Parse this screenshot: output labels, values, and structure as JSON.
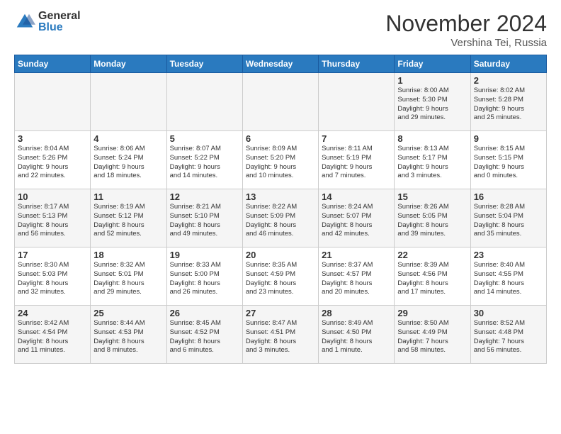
{
  "header": {
    "logo_general": "General",
    "logo_blue": "Blue",
    "month_title": "November 2024",
    "location": "Vershina Tei, Russia"
  },
  "days_of_week": [
    "Sunday",
    "Monday",
    "Tuesday",
    "Wednesday",
    "Thursday",
    "Friday",
    "Saturday"
  ],
  "weeks": [
    [
      {
        "day": "",
        "content": ""
      },
      {
        "day": "",
        "content": ""
      },
      {
        "day": "",
        "content": ""
      },
      {
        "day": "",
        "content": ""
      },
      {
        "day": "",
        "content": ""
      },
      {
        "day": "1",
        "content": "Sunrise: 8:00 AM\nSunset: 5:30 PM\nDaylight: 9 hours\nand 29 minutes."
      },
      {
        "day": "2",
        "content": "Sunrise: 8:02 AM\nSunset: 5:28 PM\nDaylight: 9 hours\nand 25 minutes."
      }
    ],
    [
      {
        "day": "3",
        "content": "Sunrise: 8:04 AM\nSunset: 5:26 PM\nDaylight: 9 hours\nand 22 minutes."
      },
      {
        "day": "4",
        "content": "Sunrise: 8:06 AM\nSunset: 5:24 PM\nDaylight: 9 hours\nand 18 minutes."
      },
      {
        "day": "5",
        "content": "Sunrise: 8:07 AM\nSunset: 5:22 PM\nDaylight: 9 hours\nand 14 minutes."
      },
      {
        "day": "6",
        "content": "Sunrise: 8:09 AM\nSunset: 5:20 PM\nDaylight: 9 hours\nand 10 minutes."
      },
      {
        "day": "7",
        "content": "Sunrise: 8:11 AM\nSunset: 5:19 PM\nDaylight: 9 hours\nand 7 minutes."
      },
      {
        "day": "8",
        "content": "Sunrise: 8:13 AM\nSunset: 5:17 PM\nDaylight: 9 hours\nand 3 minutes."
      },
      {
        "day": "9",
        "content": "Sunrise: 8:15 AM\nSunset: 5:15 PM\nDaylight: 9 hours\nand 0 minutes."
      }
    ],
    [
      {
        "day": "10",
        "content": "Sunrise: 8:17 AM\nSunset: 5:13 PM\nDaylight: 8 hours\nand 56 minutes."
      },
      {
        "day": "11",
        "content": "Sunrise: 8:19 AM\nSunset: 5:12 PM\nDaylight: 8 hours\nand 52 minutes."
      },
      {
        "day": "12",
        "content": "Sunrise: 8:21 AM\nSunset: 5:10 PM\nDaylight: 8 hours\nand 49 minutes."
      },
      {
        "day": "13",
        "content": "Sunrise: 8:22 AM\nSunset: 5:09 PM\nDaylight: 8 hours\nand 46 minutes."
      },
      {
        "day": "14",
        "content": "Sunrise: 8:24 AM\nSunset: 5:07 PM\nDaylight: 8 hours\nand 42 minutes."
      },
      {
        "day": "15",
        "content": "Sunrise: 8:26 AM\nSunset: 5:05 PM\nDaylight: 8 hours\nand 39 minutes."
      },
      {
        "day": "16",
        "content": "Sunrise: 8:28 AM\nSunset: 5:04 PM\nDaylight: 8 hours\nand 35 minutes."
      }
    ],
    [
      {
        "day": "17",
        "content": "Sunrise: 8:30 AM\nSunset: 5:03 PM\nDaylight: 8 hours\nand 32 minutes."
      },
      {
        "day": "18",
        "content": "Sunrise: 8:32 AM\nSunset: 5:01 PM\nDaylight: 8 hours\nand 29 minutes."
      },
      {
        "day": "19",
        "content": "Sunrise: 8:33 AM\nSunset: 5:00 PM\nDaylight: 8 hours\nand 26 minutes."
      },
      {
        "day": "20",
        "content": "Sunrise: 8:35 AM\nSunset: 4:59 PM\nDaylight: 8 hours\nand 23 minutes."
      },
      {
        "day": "21",
        "content": "Sunrise: 8:37 AM\nSunset: 4:57 PM\nDaylight: 8 hours\nand 20 minutes."
      },
      {
        "day": "22",
        "content": "Sunrise: 8:39 AM\nSunset: 4:56 PM\nDaylight: 8 hours\nand 17 minutes."
      },
      {
        "day": "23",
        "content": "Sunrise: 8:40 AM\nSunset: 4:55 PM\nDaylight: 8 hours\nand 14 minutes."
      }
    ],
    [
      {
        "day": "24",
        "content": "Sunrise: 8:42 AM\nSunset: 4:54 PM\nDaylight: 8 hours\nand 11 minutes."
      },
      {
        "day": "25",
        "content": "Sunrise: 8:44 AM\nSunset: 4:53 PM\nDaylight: 8 hours\nand 8 minutes."
      },
      {
        "day": "26",
        "content": "Sunrise: 8:45 AM\nSunset: 4:52 PM\nDaylight: 8 hours\nand 6 minutes."
      },
      {
        "day": "27",
        "content": "Sunrise: 8:47 AM\nSunset: 4:51 PM\nDaylight: 8 hours\nand 3 minutes."
      },
      {
        "day": "28",
        "content": "Sunrise: 8:49 AM\nSunset: 4:50 PM\nDaylight: 8 hours\nand 1 minute."
      },
      {
        "day": "29",
        "content": "Sunrise: 8:50 AM\nSunset: 4:49 PM\nDaylight: 7 hours\nand 58 minutes."
      },
      {
        "day": "30",
        "content": "Sunrise: 8:52 AM\nSunset: 4:48 PM\nDaylight: 7 hours\nand 56 minutes."
      }
    ]
  ]
}
